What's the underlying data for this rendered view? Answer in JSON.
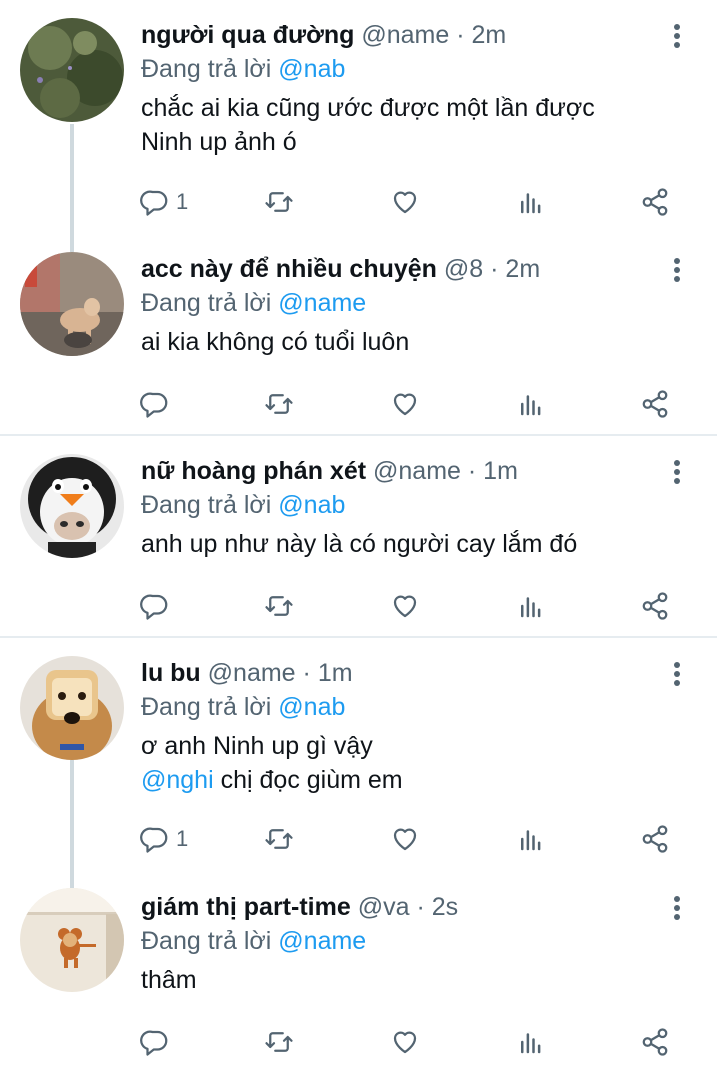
{
  "tweets": [
    {
      "name": "người qua đường",
      "handle": "@name",
      "time": "· 2m",
      "reply_prefix": "Đang trả lời",
      "reply_to": "@nab",
      "text_lines": [
        "chắc ai kia cũng ước được một lần được",
        "Ninh up ảnh ó"
      ],
      "reply_count": "1",
      "avatar": "grass-avatar"
    },
    {
      "name": "acc này để nhiều chuyện",
      "handle": "@8",
      "time": "· 2m",
      "reply_prefix": "Đang trả lời",
      "reply_to": "@name",
      "text_lines": [
        "ai kia không có tuổi luôn"
      ],
      "reply_count": "",
      "avatar": "dog-avatar"
    },
    {
      "name": "nữ hoàng phán xét",
      "handle": "@name",
      "time": "· 1m",
      "reply_prefix": "Đang trả lời",
      "reply_to": "@nab",
      "text_lines": [
        "anh up như này là có người cay lắm đó"
      ],
      "reply_count": "",
      "avatar": "penguin-avatar"
    },
    {
      "name": "lu bu",
      "handle": "@name",
      "time": "· 1m",
      "reply_prefix": "Đang trả lời",
      "reply_to": "@nab",
      "text_lines": [
        "ơ anh Ninh up gì vậy"
      ],
      "text_mention": "@nghi",
      "text_after_mention": " chị đọc giùm em",
      "reply_count": "1",
      "avatar": "bread-dog-avatar"
    },
    {
      "name": "giám thị part-time",
      "handle": "@va",
      "time": "· 2s",
      "reply_prefix": "Đang trả lời",
      "reply_to": "@name",
      "text_lines": [
        "thâm"
      ],
      "reply_count": "",
      "avatar": "mouse-avatar"
    }
  ],
  "icons": {
    "reply": "reply-icon",
    "retweet": "retweet-icon",
    "like": "heart-icon",
    "views": "views-icon",
    "share": "share-icon",
    "more": "more-icon"
  },
  "colors": {
    "link": "#1d9bf0",
    "muted": "#536471",
    "text": "#0f1419",
    "separator": "#e6ecf0"
  }
}
